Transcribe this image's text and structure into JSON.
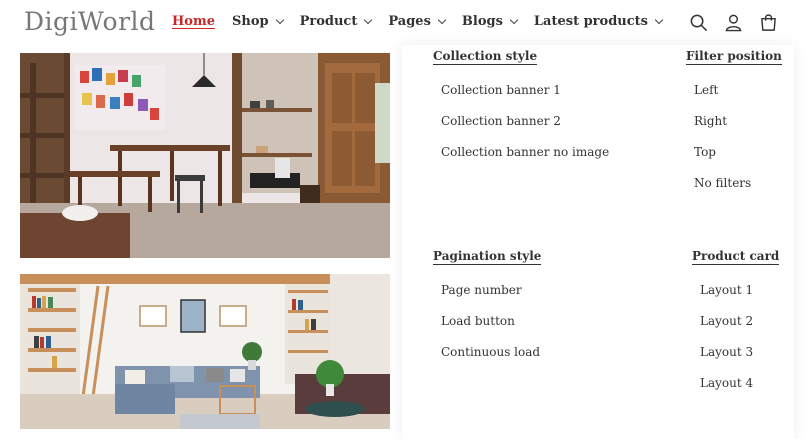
{
  "logo": "DigiWorld",
  "nav": [
    {
      "label": "Home",
      "active": true,
      "dropdown": false
    },
    {
      "label": "Shop",
      "active": false,
      "dropdown": true
    },
    {
      "label": "Product",
      "active": false,
      "dropdown": true
    },
    {
      "label": "Pages",
      "active": false,
      "dropdown": true
    },
    {
      "label": "Blogs",
      "active": false,
      "dropdown": true
    },
    {
      "label": "Latest products",
      "active": false,
      "dropdown": true
    }
  ],
  "header_icons": [
    "search-icon",
    "account-icon",
    "cart-icon"
  ],
  "images": [
    {
      "name": "kitchen-interior-image"
    },
    {
      "name": "living-room-interior-image"
    }
  ],
  "menu": {
    "collection_style": {
      "title": "Collection style",
      "items": [
        "Collection banner 1",
        "Collection banner 2",
        "Collection banner no image"
      ]
    },
    "filter_position": {
      "title": "Filter position",
      "items": [
        "Left",
        "Right",
        "Top",
        "No filters"
      ]
    },
    "pagination_style": {
      "title": "Pagination style",
      "items": [
        "Page number",
        "Load button",
        "Continuous load"
      ]
    },
    "product_card": {
      "title": "Product card",
      "items": [
        "Layout 1",
        "Layout 2",
        "Layout 3",
        "Layout 4"
      ]
    }
  },
  "colors": {
    "active_nav": "#c62828",
    "text": "#333333",
    "logo": "#777777"
  }
}
